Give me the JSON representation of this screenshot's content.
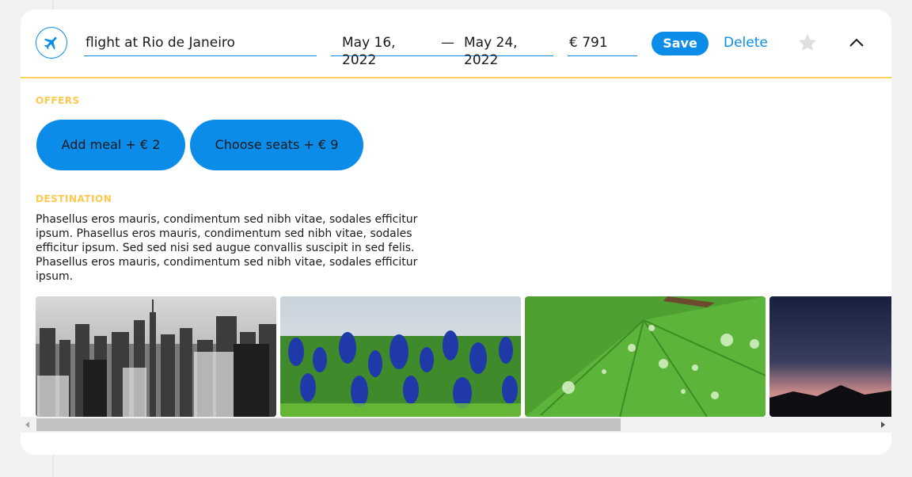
{
  "point": {
    "type_icon": "airplane-icon",
    "destination": "flight at Rio de Janeiro",
    "date_from": "May 16, 2022",
    "date_separator": "—",
    "date_to": "May 24, 2022",
    "price": "€ 791",
    "save_label": "Save",
    "delete_label": "Delete",
    "favorite_icon": "star-icon",
    "collapse_icon": "chevron-up-icon"
  },
  "offers": {
    "title": "OFFERS",
    "items": [
      {
        "label": "Add meal + € 2"
      },
      {
        "label": "Choose seats + € 9"
      }
    ]
  },
  "destination": {
    "title": "DESTINATION",
    "description": "Phasellus eros mauris, condimentum sed nibh vitae, sodales efficitur ipsum. Phasellus eros mauris, condimentum sed nibh vitae, sodales efficitur ipsum. Sed sed nisi sed augue convallis suscipit in sed felis. Phasellus eros mauris, condimentum sed nibh vitae, sodales efficitur ipsum.",
    "photos": [
      {
        "subject": "city-skyline-photo"
      },
      {
        "subject": "bluebonnet-flowers-photo"
      },
      {
        "subject": "leaf-water-drops-photo"
      },
      {
        "subject": "mountain-sunset-photo"
      }
    ]
  },
  "colors": {
    "accent": "#0c8ce9",
    "section_title": "#ffc94d",
    "divider": "#ffd060",
    "star_inactive": "#e0e0e0"
  },
  "scrollbar": {
    "position_fraction": 0.0
  }
}
